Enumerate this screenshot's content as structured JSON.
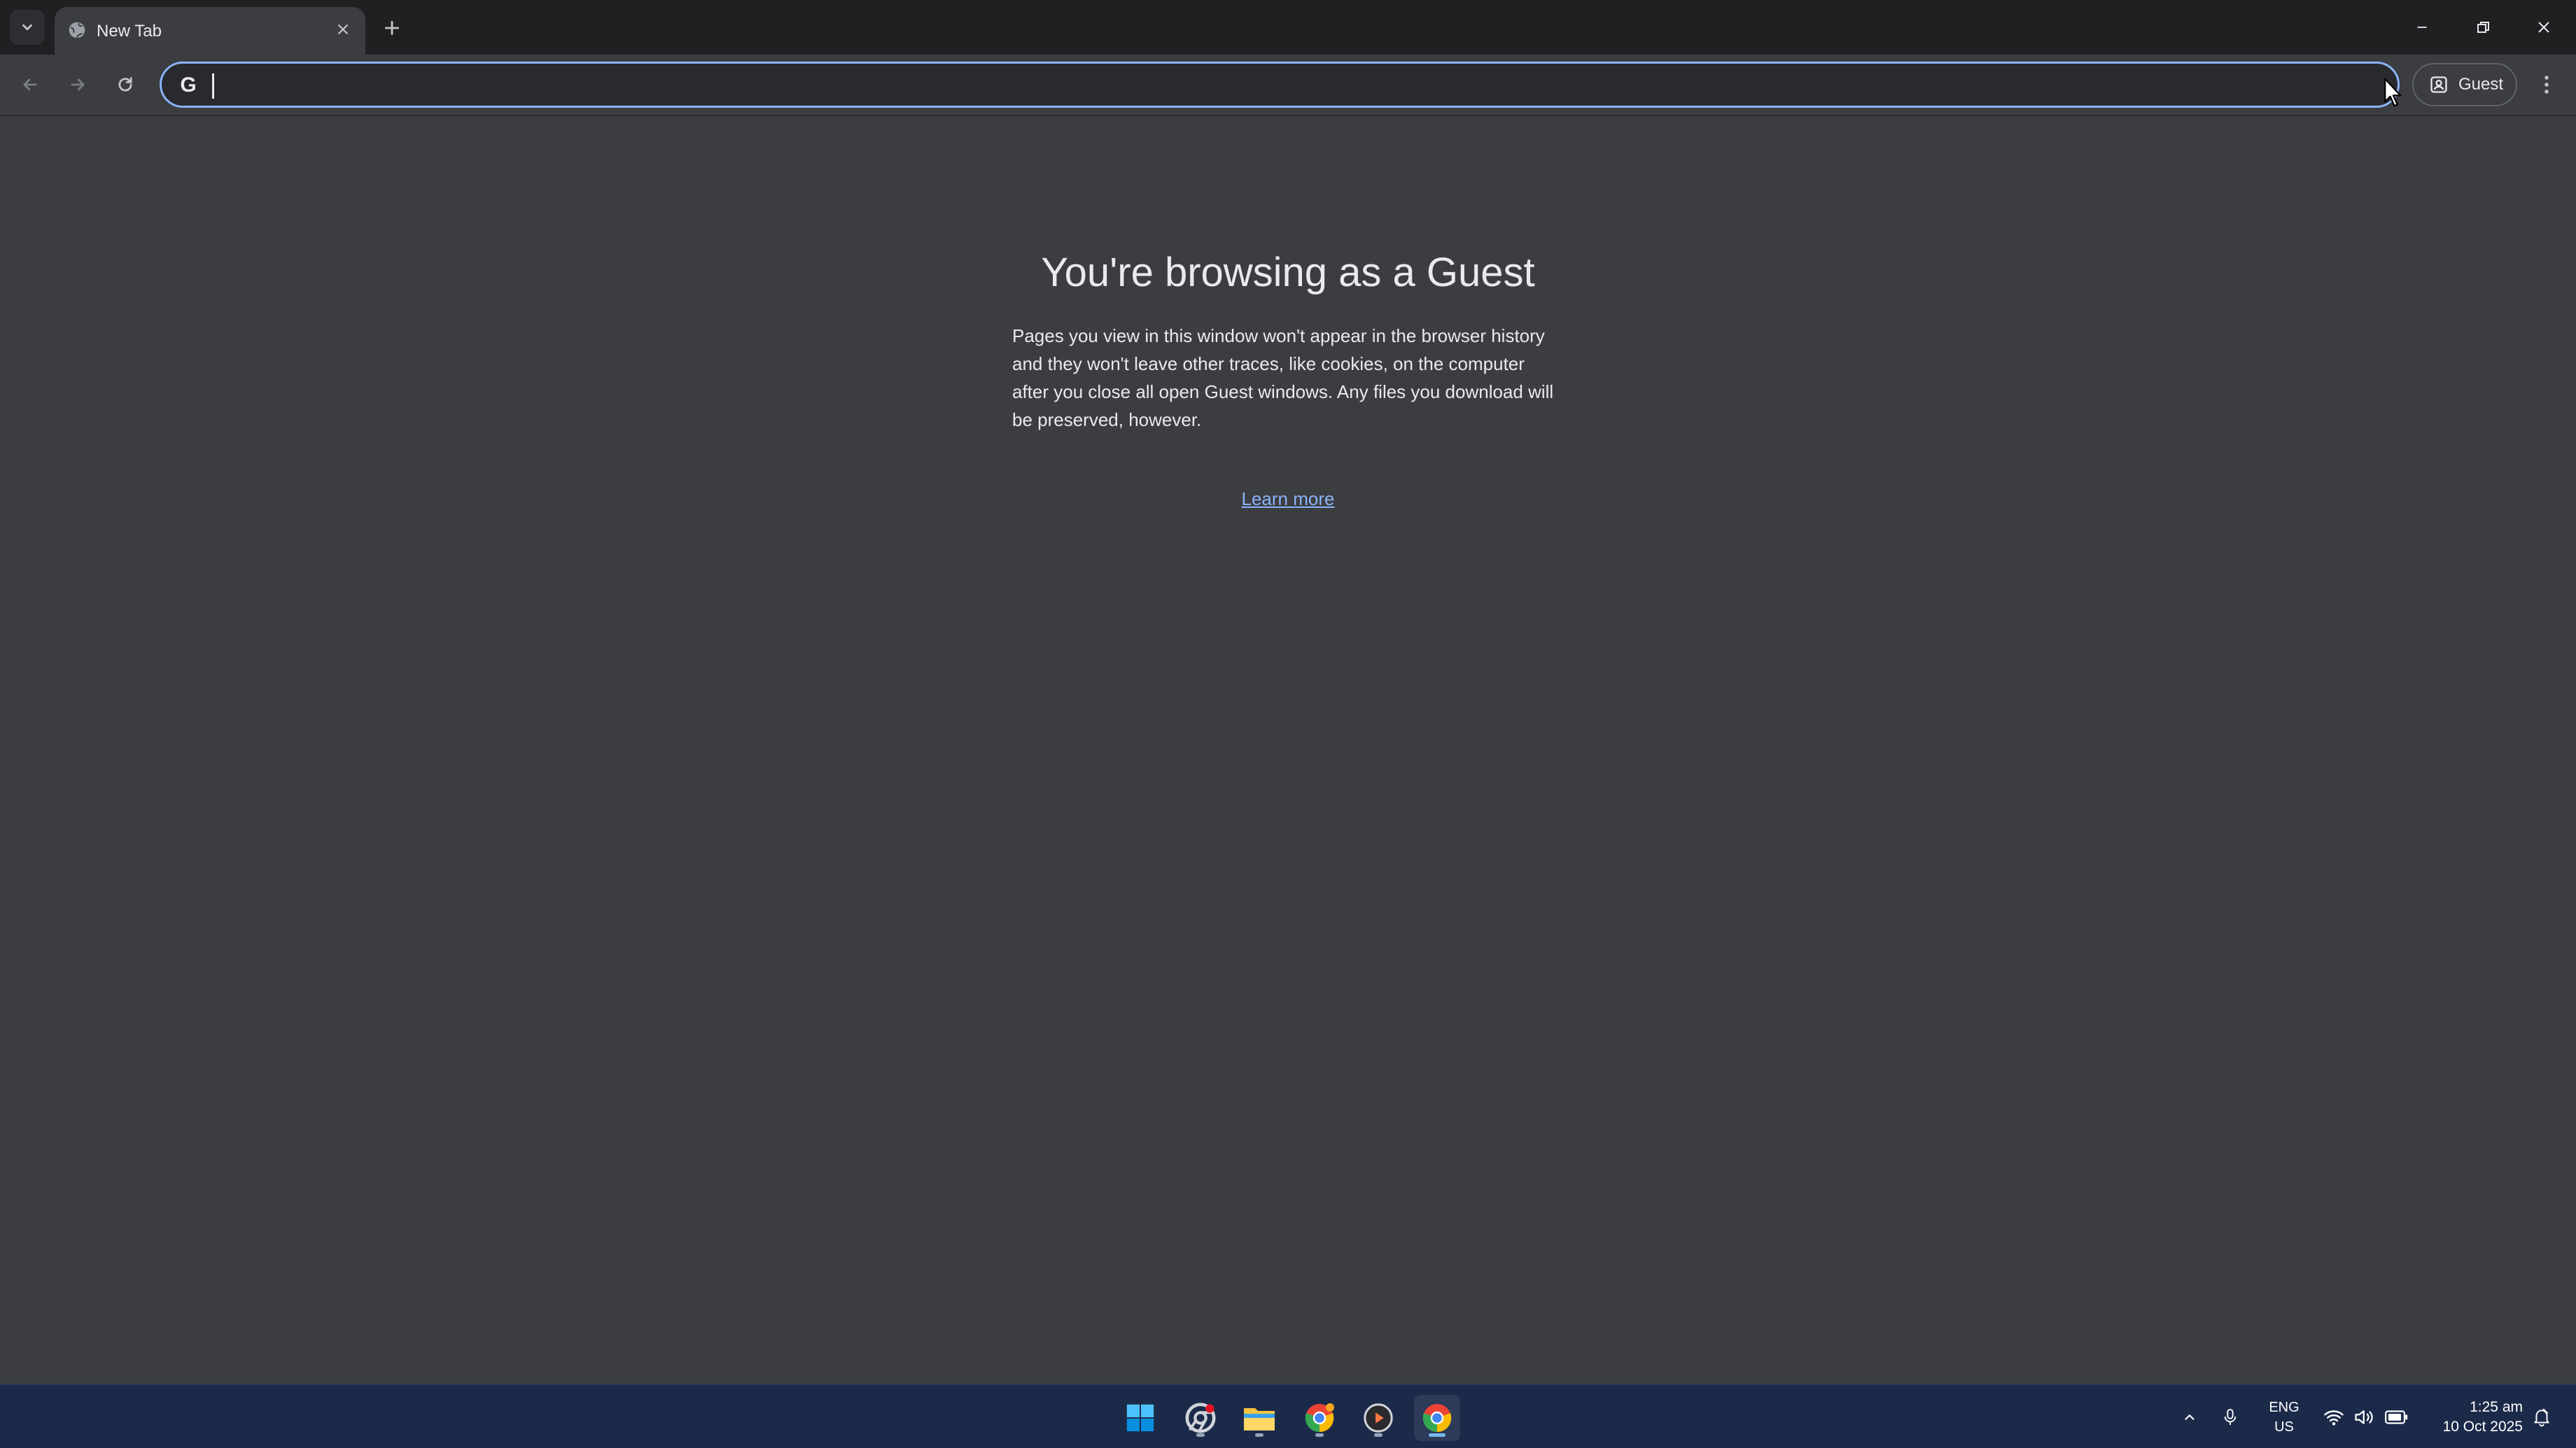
{
  "browser": {
    "tab": {
      "title": "New Tab"
    },
    "omnibox": {
      "value": "",
      "placeholder": ""
    },
    "profile": {
      "label": "Guest"
    },
    "colors": {
      "accent": "#8ab4f8",
      "background": "#3c3d41",
      "tabstrip": "#1f2022"
    }
  },
  "page": {
    "title": "You're browsing as a Guest",
    "body": "Pages you view in this window won't appear in the browser history and they won't leave other traces, like cookies, on the computer after you close all open Guest windows. Any files you download will be preserved, however.",
    "learn_more": "Learn more"
  },
  "taskbar": {
    "apps": [
      "windows-start",
      "chrome-beta",
      "file-explorer",
      "chrome-canary",
      "media-player",
      "chrome"
    ],
    "lang_primary": "ENG",
    "lang_secondary": "US",
    "time": "1:25 am",
    "date": "10 Oct 2025"
  }
}
